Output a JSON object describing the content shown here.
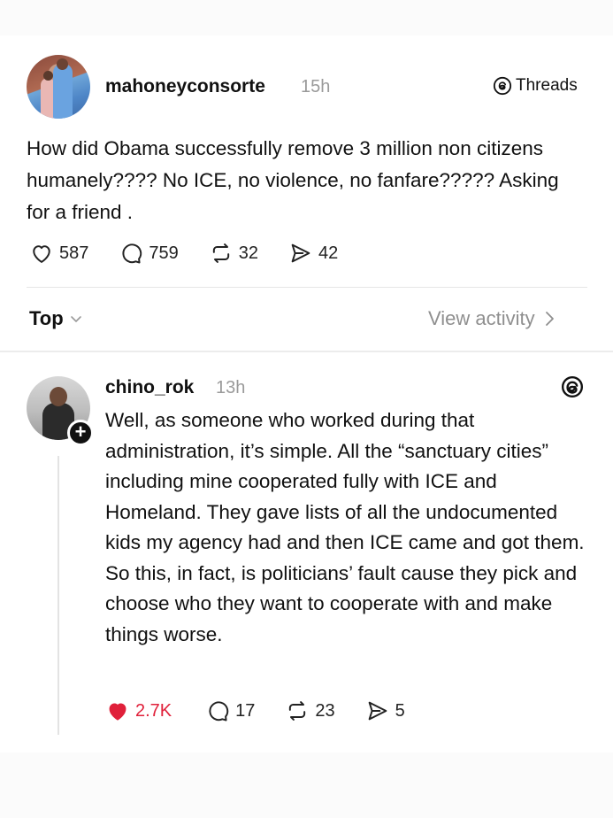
{
  "post": {
    "username": "mahoneyconsorte",
    "time": "15h",
    "badge": "Threads",
    "text": "How did Obama successfully remove 3 million non citizens humanely???? No ICE, no violence, no fanfare????? Asking for a friend .",
    "stats": {
      "likes": "587",
      "replies": "759",
      "reposts": "32",
      "shares": "42"
    }
  },
  "filter": {
    "label": "Top",
    "view_activity": "View activity"
  },
  "reply": {
    "username": "chino_rok",
    "time": "13h",
    "text": "Well, as someone who worked during that administration, it’s simple. All the “sanctuary cities” including mine cooperated fully with ICE and Homeland. They gave lists of all the undocumented kids my agency had and then ICE came and got them. So this, in fact, is politicians’ fault cause they pick and choose who they want to cooperate with and make things worse.",
    "stats": {
      "likes": "2.7K",
      "replies": "17",
      "reposts": "23",
      "shares": "5"
    },
    "liked": true
  },
  "colors": {
    "like_active": "#e0203a",
    "muted_text": "#9a9a9a"
  },
  "icons": [
    "heart-icon",
    "comment-icon",
    "repost-icon",
    "share-icon",
    "threads-logo-icon",
    "chevron-down-icon",
    "chevron-right-icon",
    "follow-plus-icon"
  ]
}
